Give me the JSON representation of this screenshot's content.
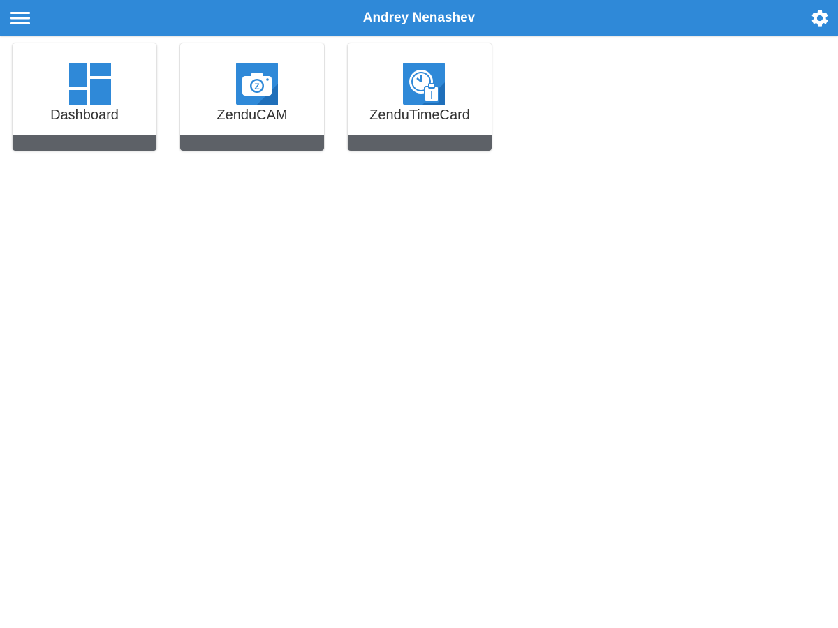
{
  "header": {
    "title": "Andrey Nenashev",
    "menu_icon": "hamburger-menu-icon",
    "settings_icon": "gear-icon",
    "background_color": "#2f89d8"
  },
  "tiles": [
    {
      "label": "Dashboard",
      "icon": "dashboard-icon"
    },
    {
      "label": "ZenduCAM",
      "icon": "camera-icon"
    },
    {
      "label": "ZenduTimeCard",
      "icon": "timecard-clock-icon"
    }
  ],
  "colors": {
    "accent": "#2f89d8",
    "tile_footer": "#5d6167",
    "icon_blue": "#2f89d8"
  }
}
